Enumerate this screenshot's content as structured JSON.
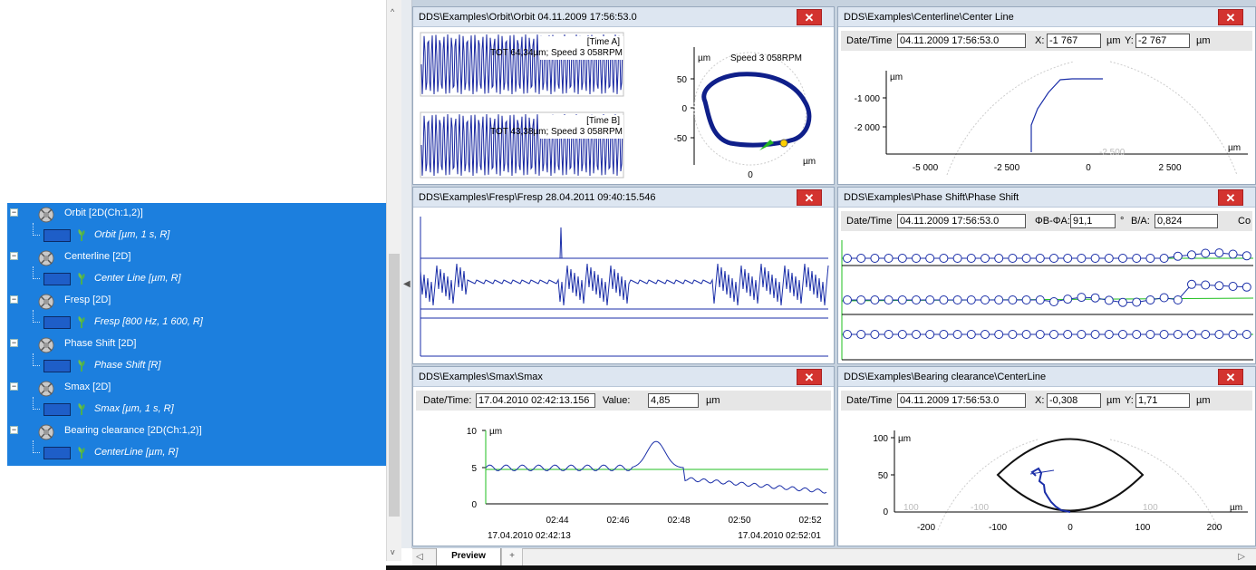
{
  "tree": {
    "items": [
      {
        "label": "Orbit [2D(Ch:1,2)]",
        "expander": "−",
        "child": "Orbit [µm, 1 s, R]"
      },
      {
        "label": "Centerline [2D]",
        "expander": "−",
        "child": "Center Line [µm, R]"
      },
      {
        "label": "Fresp [2D]",
        "expander": "−",
        "child": "Fresp [800 Hz, 1 600, R]"
      },
      {
        "label": "Phase Shift [2D]",
        "expander": "−",
        "child": "Phase Shift [R]"
      },
      {
        "label": "Smax [2D]",
        "expander": "−",
        "child": "Smax [µm, 1 s, R]"
      },
      {
        "label": "Bearing clearance [2D(Ch:1,2)]",
        "expander": "−",
        "child": "CenterLine [µm, R]"
      }
    ]
  },
  "panels": {
    "orbit": {
      "title": "DDS\\Examples\\Orbit\\Orbit    04.11.2009 17:56:53.0",
      "close": "✕",
      "waveA_tag": "[Time A]",
      "waveA_text": "TOT 64,34µm; Speed 3 058RPM",
      "waveB_tag": "[Time B]",
      "waveB_text": "TOT 43,38µm; Speed 3 058RPM",
      "unit": "µm",
      "speed": "Speed 3 058RPM",
      "y_ticks": [
        "50",
        "0",
        "-50"
      ],
      "x_tick": "0",
      "x_unit": "µm"
    },
    "centerline": {
      "title": "DDS\\Examples\\Centerline\\Center Line",
      "close": "✕",
      "date_label": "Date/Time",
      "date_value": "04.11.2009 17:56:53.0",
      "x_label": "X:",
      "x_value": "-1 767",
      "x_unit": "µm",
      "y_label": "Y:",
      "y_value": "-2 767",
      "y_unit": "µm",
      "axis_unit": "µm",
      "y_ticks": [
        "-1 000",
        "-2 000"
      ],
      "x_ticks": [
        "-5 000",
        "-2 500",
        "0",
        "2 500"
      ],
      "arc_label": "-2 500",
      "x_axis_unit": "µm"
    },
    "fresp": {
      "title": "DDS\\Examples\\Fresp\\Fresp    28.04.2011 09:40:15.546",
      "close": "✕"
    },
    "phase": {
      "title": "DDS\\Examples\\Phase Shift\\Phase Shift",
      "close": "✕",
      "date_label": "Date/Time",
      "date_value": "04.11.2009 17:56:53.0",
      "phase_label": "ΦB-ΦA:",
      "phase_value": "91,1",
      "deg": "°",
      "ratio_label": "B/A:",
      "ratio_value": "0,824",
      "extra": "Co"
    },
    "smax": {
      "title": "DDS\\Examples\\Smax\\Smax",
      "close": "✕",
      "date_label": "Date/Time:",
      "date_value": "17.04.2010 02:42:13.156",
      "value_label": "Value:",
      "value": "4,85",
      "unit": "µm",
      "y_ticks": [
        "10",
        "5",
        "0"
      ],
      "y_unit": "µm",
      "x_ticks": [
        "02:44",
        "02:46",
        "02:48",
        "02:50",
        "02:52"
      ],
      "start": "17.04.2010 02:42:13",
      "end": "17.04.2010 02:52:01"
    },
    "bearing": {
      "title": "DDS\\Examples\\Bearing clearance\\CenterLine",
      "close": "✕",
      "date_label": "Date/Time",
      "date_value": "04.11.2009 17:56:53.0",
      "x_label": "X:",
      "x_value": "-0,308",
      "x_unit": "µm",
      "y_label": "Y:",
      "y_value": "1,71",
      "y_unit": "µm",
      "axis_unit": "µm",
      "y_ticks": [
        "100",
        "50",
        "0"
      ],
      "x_ticks": [
        "-200",
        "-100",
        "0",
        "100",
        "200"
      ],
      "arc_left": "100",
      "arc_left2": "-100",
      "arc_right": "100",
      "x_axis_unit": "µm"
    }
  },
  "tabs": {
    "active": "Preview",
    "add": "+",
    "nav_left": "◁",
    "nav_right": "▷"
  },
  "scroll": {
    "up": "^",
    "down": "v",
    "collapse": "◀"
  }
}
